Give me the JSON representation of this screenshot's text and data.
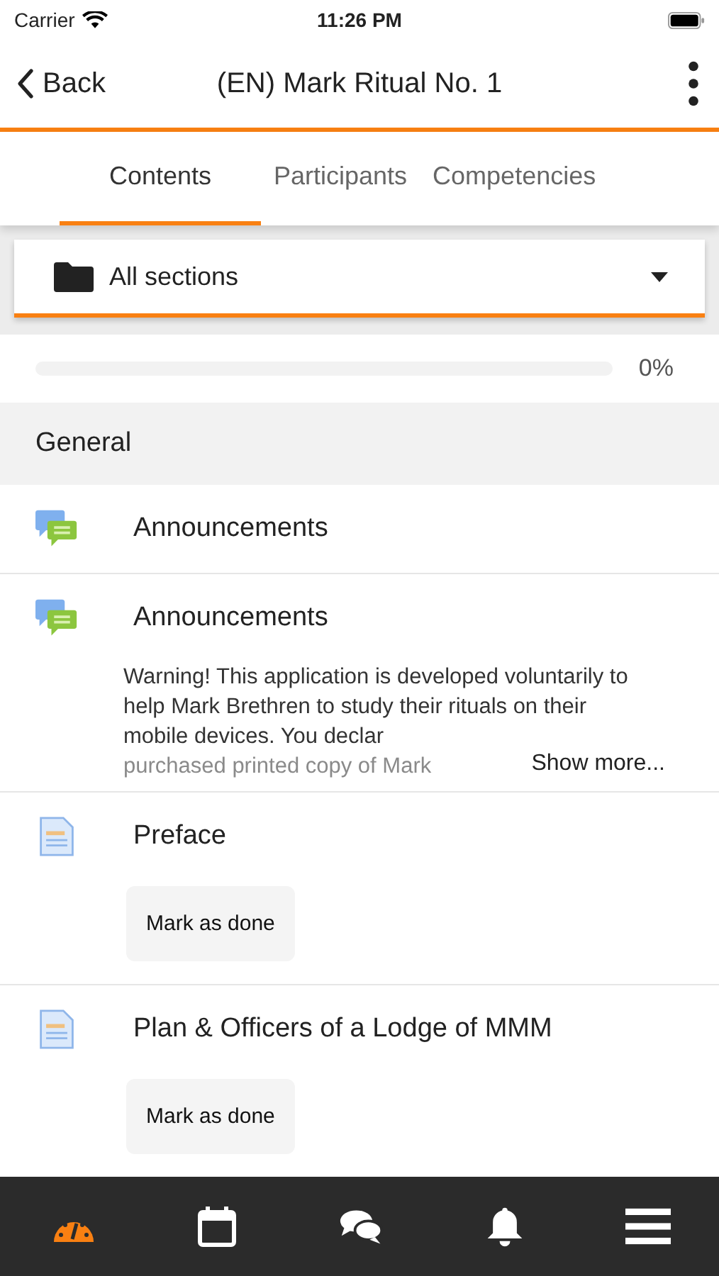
{
  "status_bar": {
    "carrier": "Carrier",
    "time": "11:26 PM"
  },
  "header": {
    "back": "Back",
    "title": "(EN) Mark Ritual No. 1"
  },
  "tabs": [
    {
      "label": "Contents",
      "selected": true
    },
    {
      "label": "Participants",
      "selected": false
    },
    {
      "label": "Competencies",
      "selected": false
    }
  ],
  "section_select": {
    "value": "All sections"
  },
  "progress": {
    "level": 0,
    "reading": "0%"
  },
  "section": {
    "title": "General"
  },
  "activities": [
    {
      "kind": "forum",
      "title": "Announcements"
    },
    {
      "kind": "forum",
      "title": "Announcements",
      "description": "Warning! This application is developed voluntarily to help Mark Brethren to study their rituals on their mobile devices. You declar",
      "description_faded": "purchased printed copy of Mark",
      "more": "Show more..."
    },
    {
      "kind": "page",
      "title": "Preface",
      "button": "Mark as done"
    },
    {
      "kind": "page",
      "title": "Plan & Officers of a Lodge of MMM",
      "button": "Mark as done"
    }
  ],
  "tab_bar": [
    {
      "kind": "dashboard",
      "selected": true
    },
    {
      "kind": "calendar",
      "selected": false
    },
    {
      "kind": "messages",
      "selected": false
    },
    {
      "kind": "notifications",
      "selected": false
    },
    {
      "kind": "menu",
      "selected": false
    }
  ]
}
